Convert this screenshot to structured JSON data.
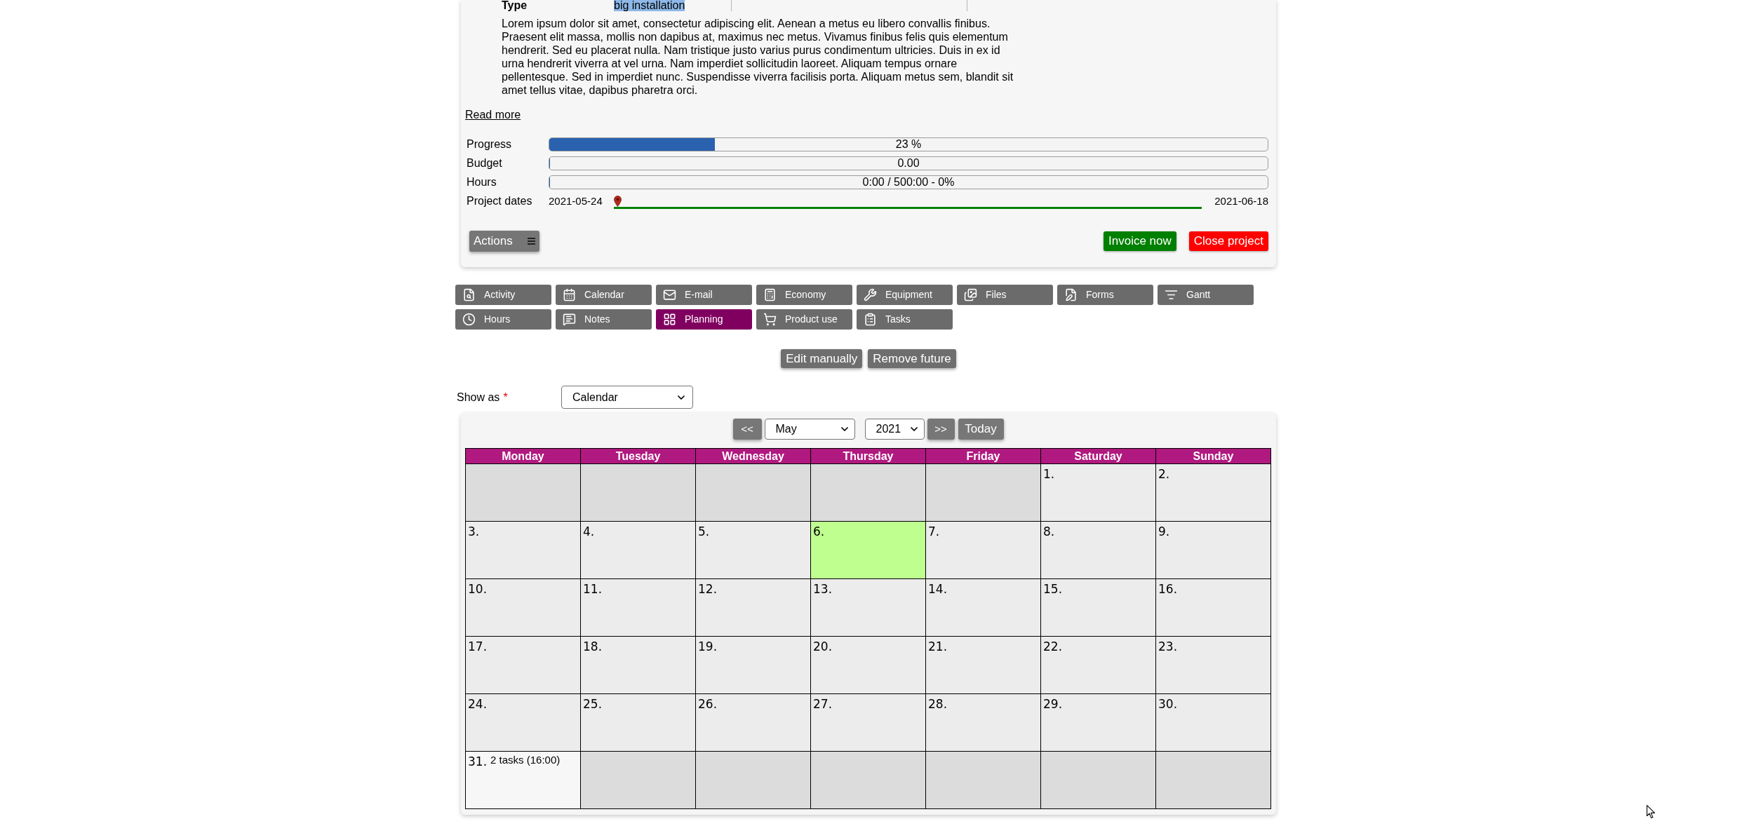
{
  "project": {
    "type_label": "Type",
    "type": {
      "value": "big installation",
      "highlighted": true
    },
    "description": "Lorem ipsum dolor sit amet, consectetur adipiscing elit. Aenean a metus eu libero convallis finibus. Praesent elit massa, mollis non dapibus at, maximus nec metus. Vivamus finibus felis quis elementum hendrerit. Sed eu placerat nulla. Nam tristique justo varius purus condimentum ultricies. Duis in ex id urna hendrerit viverra at vel urna. Nam imperdiet sollicitudin laoreet. Aliquam tempus ornare pellentesque. Sed in imperdiet nunc. Suspendisse viverra facilisis porta. Aliquam metus sem, blandit sit amet tellus vitae, dapibus pharetra orci.",
    "read_more": "Read more",
    "metrics": [
      {
        "label": "Progress",
        "level": 0.23,
        "reading": "23 %"
      },
      {
        "label": "Budget",
        "level": 0,
        "reading": "0.00"
      },
      {
        "label": "Hours",
        "level": 0,
        "reading": "0:00 / 500:00 - 0%"
      }
    ],
    "dates": {
      "label": "Project dates",
      "start": "2021-05-24",
      "end": "2021-06-18"
    },
    "actions": {
      "label": "Actions"
    },
    "buttons": [
      {
        "label": "Invoice now",
        "kind": "invoice"
      },
      {
        "label": "Close project",
        "kind": "close"
      }
    ]
  },
  "tabs": [
    {
      "label": "Activity",
      "selected": false
    },
    {
      "label": "Calendar",
      "selected": false
    },
    {
      "label": "E-mail",
      "selected": false
    },
    {
      "label": "Economy",
      "selected": false
    },
    {
      "label": "Equipment",
      "selected": false
    },
    {
      "label": "Files",
      "selected": false
    },
    {
      "label": "Forms",
      "selected": false
    },
    {
      "label": "Gantt",
      "selected": false
    },
    {
      "label": "Hours",
      "selected": false
    },
    {
      "label": "Notes",
      "selected": false
    },
    {
      "label": "Planning",
      "selected": true
    },
    {
      "label": "Product use",
      "selected": false
    },
    {
      "label": "Tasks",
      "selected": false
    }
  ],
  "planning_buttons": [
    "Edit manually",
    "Remove future"
  ],
  "show_as": {
    "label": "Show as",
    "required_mark": "*",
    "value": "Calendar"
  },
  "calendar": {
    "nav": {
      "prev": "<<",
      "month": "May",
      "year": "2021",
      "next": ">>",
      "today": "Today"
    },
    "weekdays": [
      "Monday",
      "Tuesday",
      "Wednesday",
      "Thursday",
      "Friday",
      "Saturday",
      "Sunday"
    ],
    "weeks": [
      {
        "days": [
          {
            "in_month": false,
            "today": false
          },
          {
            "in_month": false,
            "today": false
          },
          {
            "in_month": false,
            "today": false
          },
          {
            "in_month": false,
            "today": false
          },
          {
            "in_month": false,
            "today": false
          },
          {
            "day": "1.",
            "in_month": true,
            "today": false
          },
          {
            "day": "2.",
            "in_month": true,
            "today": false
          }
        ]
      },
      {
        "days": [
          {
            "day": "3.",
            "in_month": true,
            "today": false
          },
          {
            "day": "4.",
            "in_month": true,
            "today": false
          },
          {
            "day": "5.",
            "in_month": true,
            "today": false
          },
          {
            "day": "6.",
            "in_month": true,
            "today": true
          },
          {
            "day": "7.",
            "in_month": true,
            "today": false
          },
          {
            "day": "8.",
            "in_month": true,
            "today": false
          },
          {
            "day": "9.",
            "in_month": true,
            "today": false
          }
        ]
      },
      {
        "days": [
          {
            "day": "10.",
            "in_month": true,
            "today": false
          },
          {
            "day": "11.",
            "in_month": true,
            "today": false
          },
          {
            "day": "12.",
            "in_month": true,
            "today": false
          },
          {
            "day": "13.",
            "in_month": true,
            "today": false
          },
          {
            "day": "14.",
            "in_month": true,
            "today": false
          },
          {
            "day": "15.",
            "in_month": true,
            "today": false
          },
          {
            "day": "16.",
            "in_month": true,
            "today": false
          }
        ]
      },
      {
        "days": [
          {
            "day": "17.",
            "in_month": true,
            "today": false
          },
          {
            "day": "18.",
            "in_month": true,
            "today": false
          },
          {
            "day": "19.",
            "in_month": true,
            "today": false
          },
          {
            "day": "20.",
            "in_month": true,
            "today": false
          },
          {
            "day": "21.",
            "in_month": true,
            "today": false
          },
          {
            "day": "22.",
            "in_month": true,
            "today": false
          },
          {
            "day": "23.",
            "in_month": true,
            "today": false
          }
        ]
      },
      {
        "days": [
          {
            "day": "24.",
            "in_month": true,
            "today": false
          },
          {
            "day": "25.",
            "in_month": true,
            "today": false
          },
          {
            "day": "26.",
            "in_month": true,
            "today": false
          },
          {
            "day": "27.",
            "in_month": true,
            "today": false
          },
          {
            "day": "28.",
            "in_month": true,
            "today": false
          },
          {
            "day": "29.",
            "in_month": true,
            "today": false
          },
          {
            "day": "30.",
            "in_month": true,
            "today": false
          }
        ]
      },
      {
        "days": [
          {
            "day": "31.",
            "in_month": true,
            "today": false,
            "tasks": "2 tasks (16:00)"
          },
          {
            "in_month": false,
            "today": false
          },
          {
            "in_month": false,
            "today": false
          },
          {
            "in_month": false,
            "today": false
          },
          {
            "in_month": false,
            "today": false
          },
          {
            "in_month": false,
            "today": false
          },
          {
            "in_month": false,
            "today": false
          }
        ]
      }
    ]
  }
}
